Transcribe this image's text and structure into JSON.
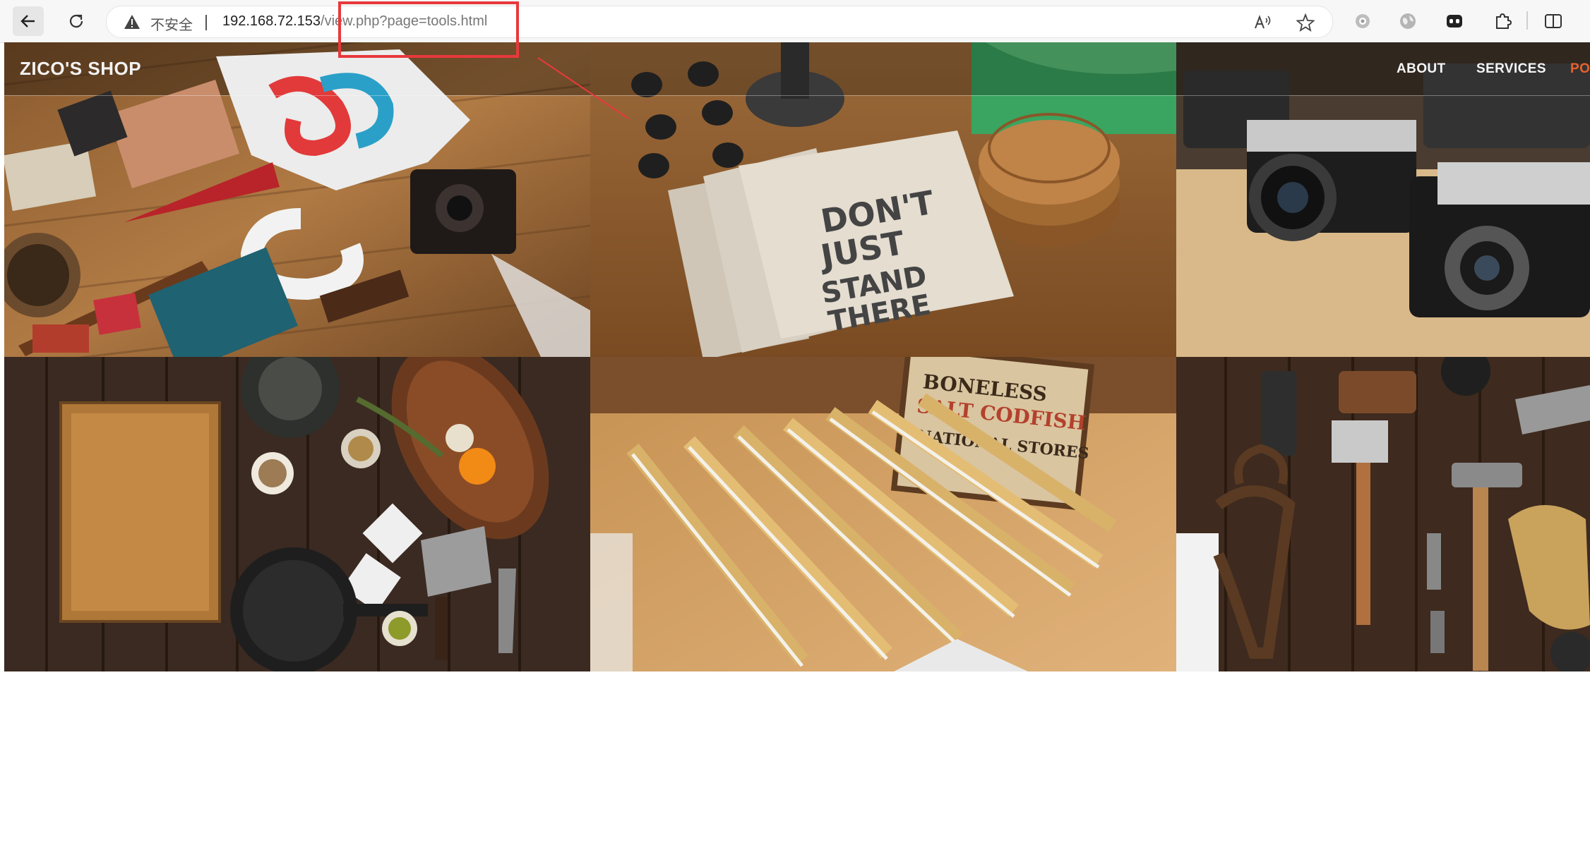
{
  "browser": {
    "security_label": "不安全",
    "url_host": "192.168.72.153",
    "url_path": "/view.php?page=tools.html",
    "icons": [
      "back-arrow-icon",
      "reload-icon",
      "warning-icon",
      "read-aloud-icon",
      "favorite-star-icon",
      "extension-icon",
      "world-icon",
      "profile-icon",
      "puzzle-icon",
      "split-screen-icon"
    ]
  },
  "site": {
    "brand": "ZICO'S SHOP",
    "nav": [
      {
        "label": "ABOUT"
      },
      {
        "label": "SERVICES"
      },
      {
        "label": "PO"
      }
    ],
    "accent_color": "#e8602c"
  },
  "gallery": {
    "tiles": [
      {
        "name": "flatlay-vintage-items"
      },
      {
        "name": "notebooks-dont-just-stand-there",
        "text": "DON'T JUST STAND THERE"
      },
      {
        "name": "vintage-cameras"
      },
      {
        "name": "kitchen-cutting-board"
      },
      {
        "name": "folding-rulers",
        "text": "BONELESS SALT CODFISH NATIONAL STORES"
      },
      {
        "name": "old-tools"
      }
    ]
  },
  "annotation_color": "#e8393c"
}
